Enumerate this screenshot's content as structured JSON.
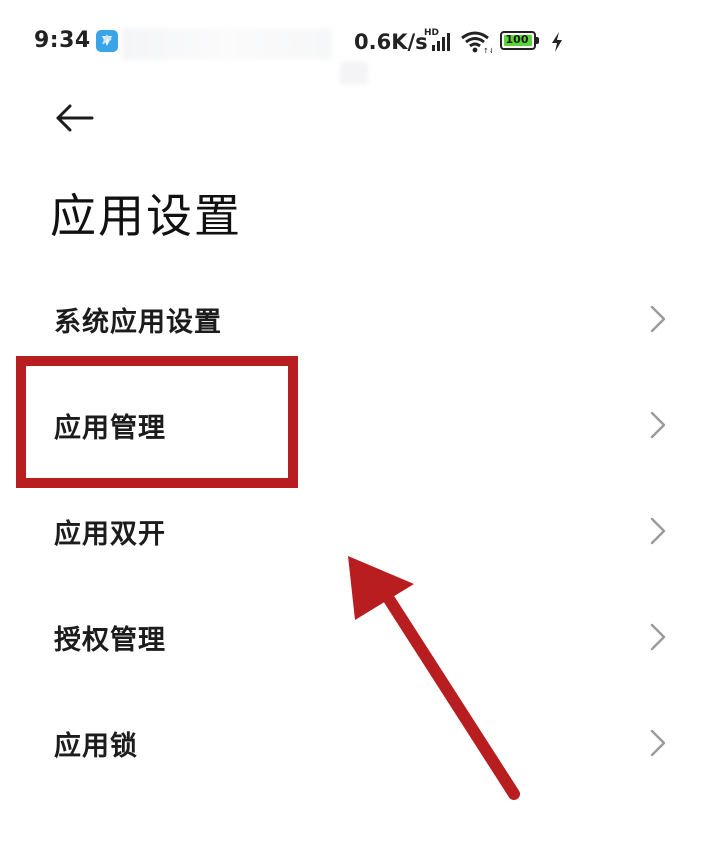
{
  "status_bar": {
    "time": "9:34",
    "net_speed": "0.6K/s",
    "signal_label": "HD",
    "battery_level": "100",
    "charging": true
  },
  "header": {
    "back_icon": "arrow-left-icon",
    "title": "应用设置"
  },
  "items": [
    {
      "label": "系统应用设置",
      "icon": "chevron-right-icon"
    },
    {
      "label": "应用管理",
      "icon": "chevron-right-icon"
    },
    {
      "label": "应用双开",
      "icon": "chevron-right-icon"
    },
    {
      "label": "授权管理",
      "icon": "chevron-right-icon"
    },
    {
      "label": "应用锁",
      "icon": "chevron-right-icon"
    }
  ],
  "annotation": {
    "highlight_color": "#b81e1f",
    "arrow_color": "#b81e1f",
    "highlighted_item": "应用管理"
  },
  "colors": {
    "battery_fill": "#5ad43a",
    "app_badge": "#3aa4e8"
  }
}
